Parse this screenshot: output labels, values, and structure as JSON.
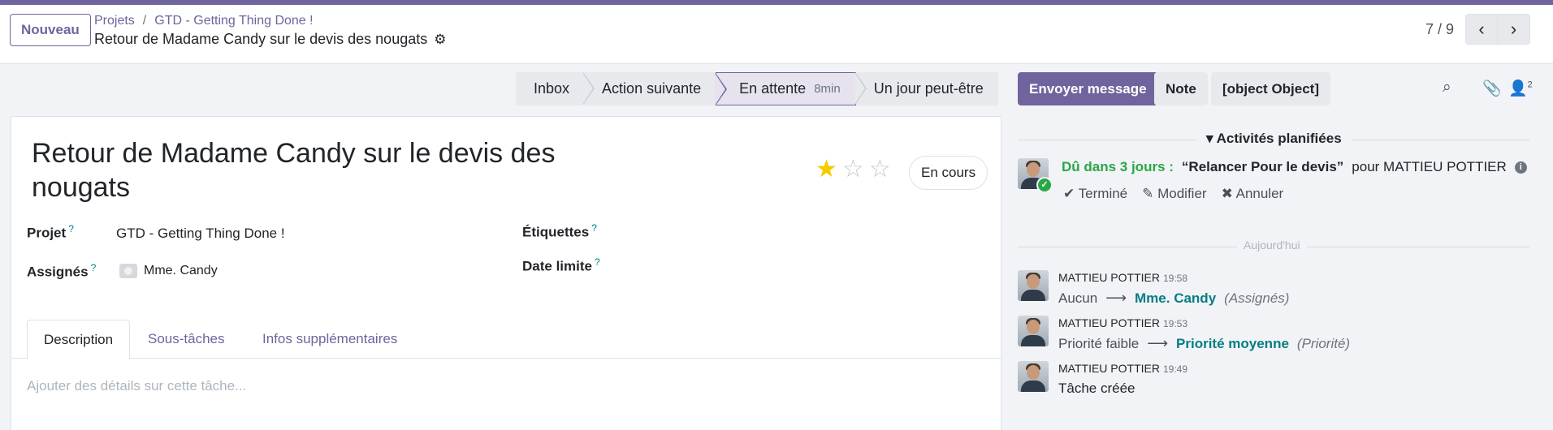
{
  "control_panel": {
    "new_label": "Nouveau",
    "breadcrumb": [
      "Projets",
      "GTD - Getting Thing Done !"
    ],
    "breadcrumb_sep": "/",
    "record_title": "Retour de Madame Candy sur le devis des nougats",
    "pager": "7 / 9"
  },
  "stages": [
    {
      "label": "Inbox"
    },
    {
      "label": "Action suivante"
    },
    {
      "label": "En attente",
      "duration": "8min",
      "active": true
    },
    {
      "label": "Un jour peut-être"
    }
  ],
  "task": {
    "title": "Retour de Madame Candy sur le devis des nougats",
    "priority_stars_filled": 1,
    "priority_stars_total": 3,
    "state": "En cours",
    "fields": {
      "projet_label": "Projet",
      "projet_value": "GTD - Getting Thing Done !",
      "assignes_label": "Assignés",
      "assignes_value": "Mme. Candy",
      "etiquettes_label": "Étiquettes",
      "date_label": "Date limite",
      "help": "?"
    },
    "tabs": [
      "Description",
      "Sous-tâches",
      "Infos supplémentaires"
    ],
    "description_placeholder": "Ajouter des détails sur cette tâche..."
  },
  "chatter": {
    "send_message": "Envoyer message",
    "note": "Note",
    "activity": {
      "due": "Dû dans 3 jours :",
      "summary": "“Relancer Pour le devis”",
      "for": "pour MATTIEU POTTIER",
      "done": "Terminé",
      "edit": "Modifier",
      "cancel": "Annuler"
    },
    "followers_count": "2",
    "planned_title": "Activités planifiées",
    "today": "Aujourd'hui",
    "messages": [
      {
        "author": "MATTIEU POTTIER",
        "time": "19:58",
        "old": "Aucun",
        "new": "Mme. Candy",
        "field": "(Assignés)"
      },
      {
        "author": "MATTIEU POTTIER",
        "time": "19:53",
        "old": "Priorité faible",
        "new": "Priorité moyenne",
        "field": "(Priorité)"
      },
      {
        "author": "MATTIEU POTTIER",
        "time": "19:49",
        "text": "Tâche créée"
      }
    ]
  }
}
